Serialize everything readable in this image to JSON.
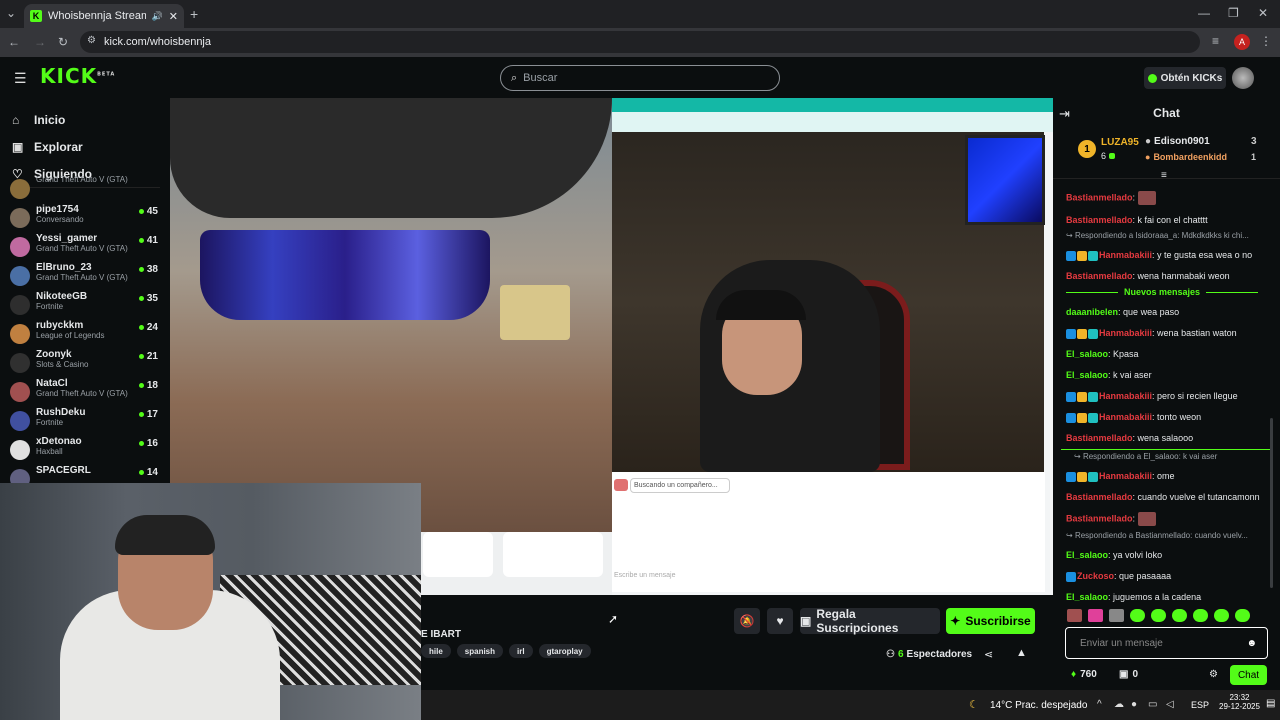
{
  "browser": {
    "tab_title": "Whoisbennja Stream - Wat",
    "url": "kick.com/whoisbennja",
    "profile_initial": "A"
  },
  "header": {
    "logo": "KICK",
    "logo_badge": "BETA",
    "search_placeholder": "Buscar",
    "get_kicks": "Obtén KICKs"
  },
  "nav": {
    "items": [
      {
        "label": "Inicio",
        "icon": "home-icon"
      },
      {
        "label": "Explorar",
        "icon": "compass-icon"
      },
      {
        "label": "Siguiendo",
        "icon": "heart-icon"
      }
    ]
  },
  "channels": [
    {
      "name": "",
      "game": "Grand Theft Auto V (GTA)",
      "count": "",
      "color": "#8a6d3b"
    },
    {
      "name": "pipe1754",
      "game": "Conversando",
      "count": "45",
      "color": "#7b6b5a"
    },
    {
      "name": "Yessi_gamer",
      "game": "Grand Theft Auto V (GTA)",
      "count": "41",
      "color": "#c06aa0"
    },
    {
      "name": "ElBruno_23",
      "game": "Grand Theft Auto V (GTA)",
      "count": "38",
      "color": "#4a6fa5"
    },
    {
      "name": "NikoteeGB",
      "game": "Fortnite",
      "count": "35",
      "color": "#2e2e2e"
    },
    {
      "name": "rubyckkm",
      "game": "League of Legends",
      "count": "24",
      "color": "#c08040"
    },
    {
      "name": "Zoonyk",
      "game": "Slots & Casino",
      "count": "21",
      "color": "#303030"
    },
    {
      "name": "NataCl",
      "game": "Grand Theft Auto V (GTA)",
      "count": "18",
      "color": "#a05050"
    },
    {
      "name": "RushDeku",
      "game": "Fortnite",
      "count": "17",
      "color": "#4050a0"
    },
    {
      "name": "xDetonao",
      "game": "Haxball",
      "count": "16",
      "color": "#e0e0e0"
    },
    {
      "name": "SPACEGRL",
      "game": "",
      "count": "14",
      "color": "#606080"
    }
  ],
  "stream": {
    "omegle_bubble": "Buscando un compañero...",
    "omegle_input": "Escribe un mensaje",
    "title_fragment": "E IBART",
    "tags": [
      "hile",
      "spanish",
      "irl",
      "gtaroplay"
    ],
    "gift_subs": "Regala Suscripciones",
    "subscribe": "Suscribirse",
    "viewers_count": "6",
    "viewers_label": "Espectadores"
  },
  "chat": {
    "title": "Chat",
    "leaderboard": {
      "rank1": {
        "rank": "1",
        "name": "LUZA95",
        "value": "6"
      },
      "rank2": {
        "name": "Edison0901",
        "value": "3"
      },
      "rank3": {
        "name": "Bombardeenkidd",
        "value": "1"
      }
    },
    "new_messages": "Nuevos mensajes",
    "messages": [
      {
        "user": "Bastianmellado",
        "text": "",
        "emote": true
      },
      {
        "user": "Bastianmellado",
        "text": "k fai con el chatttt"
      },
      {
        "reply": "Respondiendo a Isidoraaa_a: Mdkdkdkks ki chi..."
      },
      {
        "user": "Hanmabakiii",
        "text": "y te gusta esa wea o no",
        "badges": true
      },
      {
        "user": "Bastianmellado",
        "text": "wena hanmabaki weon"
      },
      {
        "user": "daaanibelen",
        "text": "que wea paso",
        "green": true
      },
      {
        "user": "Hanmabakiii",
        "text": "wena bastian waton",
        "badges": true
      },
      {
        "user": "El_salaoo",
        "text": "Kpasa",
        "green": true
      },
      {
        "user": "El_salaoo",
        "text": "k vai aser",
        "green": true
      },
      {
        "user": "Hanmabakiii",
        "text": "pero si recien llegue",
        "badges": true
      },
      {
        "user": "Hanmabakiii",
        "text": "tonto weon",
        "badges": true
      },
      {
        "user": "Bastianmellado",
        "text": "wena salaooo"
      },
      {
        "reply": "Respondiendo a El_salaoo: k vai aser"
      },
      {
        "user": "Hanmabakiii",
        "text": "ome",
        "badges": true
      },
      {
        "user": "Bastianmellado",
        "text": "cuando vuelve el tutancamonn"
      },
      {
        "user": "Bastianmellado",
        "text": "",
        "emote": true
      },
      {
        "reply": "Respondiendo a Bastianmellado: cuando vuelv..."
      },
      {
        "user": "El_salaoo",
        "text": "ya volvi loko",
        "green": true
      },
      {
        "user": "Zuckoso",
        "text": "que pasaaaa",
        "badge1": true
      },
      {
        "user": "El_salaoo",
        "text": "juguemos a la cadena",
        "green": true
      }
    ],
    "input_placeholder": "Enviar un mensaje",
    "kicks_balance": "760",
    "gift_count": "0",
    "send_label": "Chat"
  },
  "taskbar": {
    "weather": "14°C  Prac. despejado",
    "lang": "ESP",
    "time": "23:32",
    "date": "29-12-2025"
  },
  "colors": {
    "accent": "#53fc18",
    "chat_red": "#e53a40"
  }
}
